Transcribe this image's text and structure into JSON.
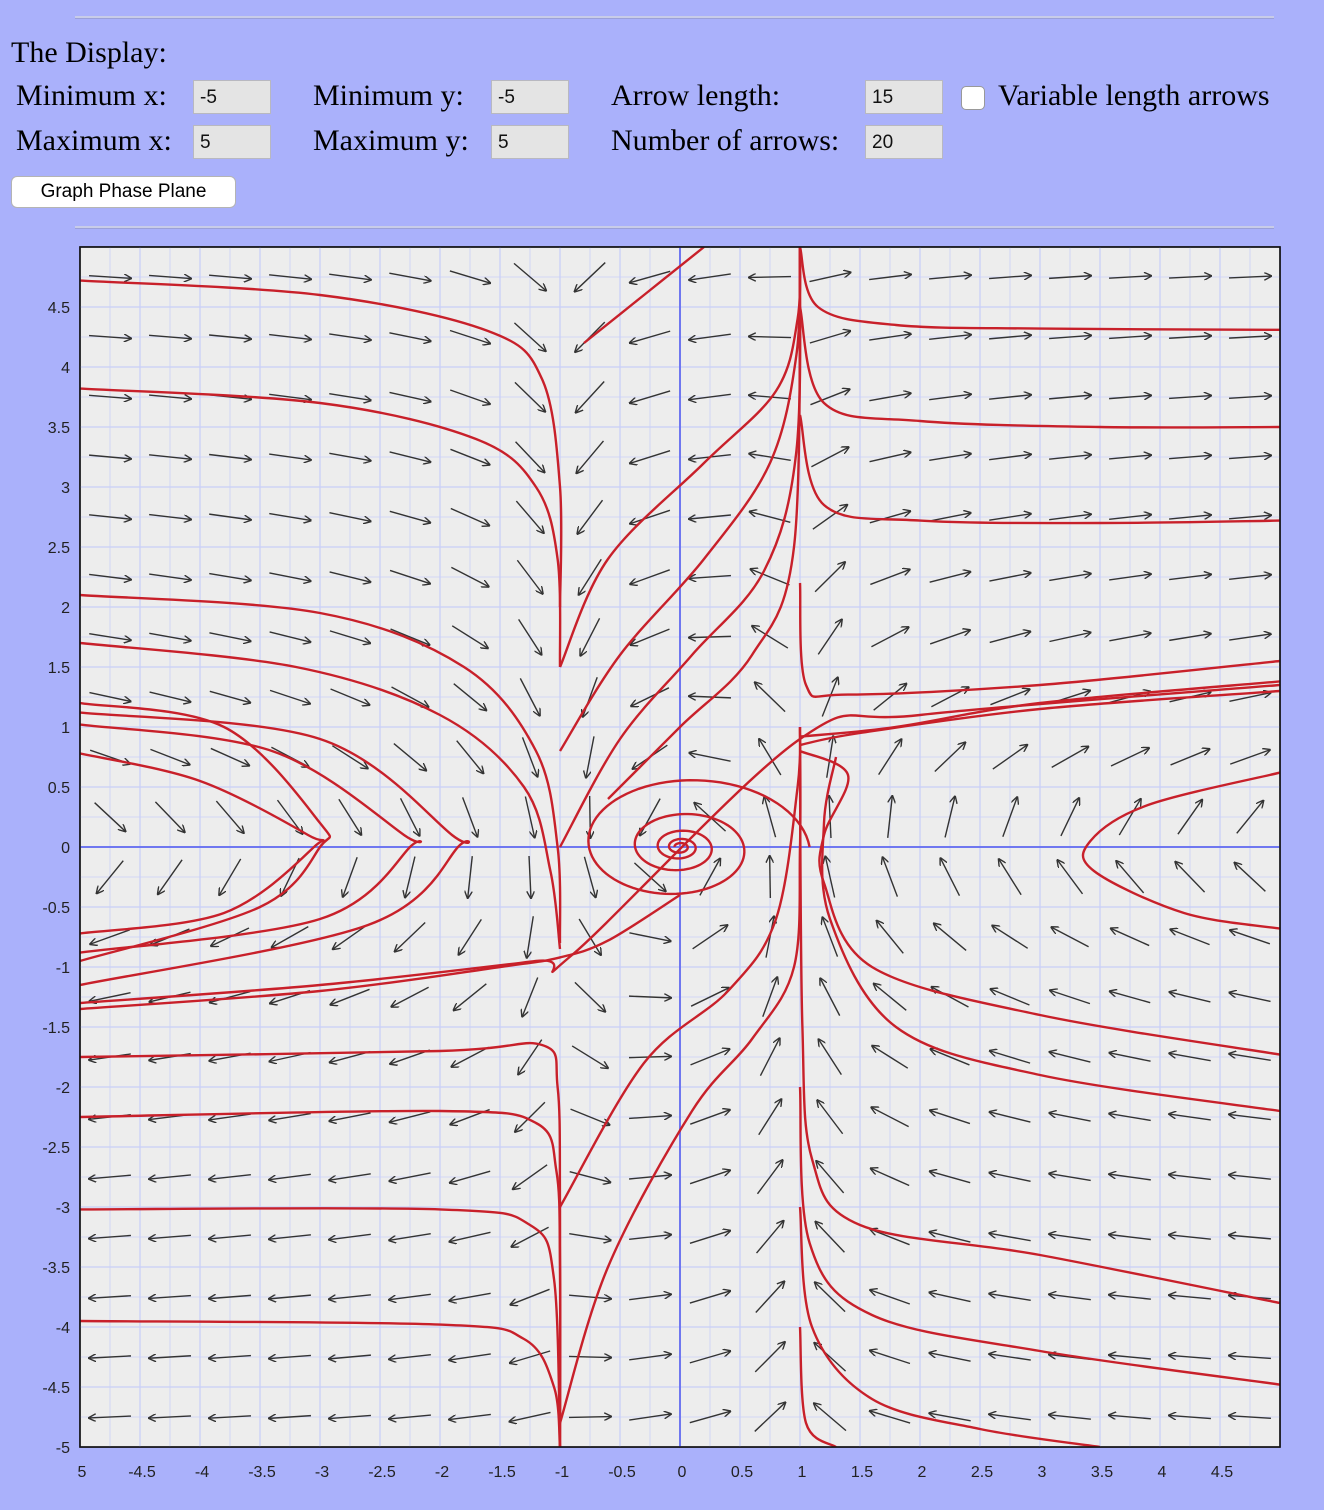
{
  "form": {
    "heading": "The Display:",
    "min_x_label": "Minimum x:",
    "min_x_value": "-5",
    "max_x_label": "Maximum x:",
    "max_x_value": "5",
    "min_y_label": "Minimum y:",
    "min_y_value": "-5",
    "max_y_label": "Maximum y:",
    "max_y_value": "5",
    "arrow_length_label": "Arrow length:",
    "arrow_length_value": "15",
    "num_arrows_label": "Number of arrows:",
    "num_arrows_value": "20",
    "variable_length_label": "Variable length arrows",
    "variable_length_checked": false,
    "graph_button": "Graph Phase Plane"
  },
  "chart_data": {
    "type": "phase-plane",
    "xlim": [
      -5,
      5
    ],
    "ylim": [
      -5,
      5
    ],
    "grid": true,
    "x_ticks": [
      "5",
      "-4.5",
      "-4",
      "-3.5",
      "-3",
      "-2.5",
      "-2",
      "-1.5",
      "-1",
      "-0.5",
      "0",
      "0.5",
      "1",
      "1.5",
      "2",
      "2.5",
      "3",
      "3.5",
      "4",
      "4.5"
    ],
    "x_tick_values": [
      -5,
      -4.5,
      -4,
      -3.5,
      -3,
      -2.5,
      -2,
      -1.5,
      -1,
      -0.5,
      0,
      0.5,
      1,
      1.5,
      2,
      2.5,
      3,
      3.5,
      4,
      4.5
    ],
    "y_ticks": [
      "4.5",
      "4",
      "3.5",
      "3",
      "2.5",
      "2",
      "1.5",
      "1",
      "0.5",
      "0",
      "-0.5",
      "-1",
      "-1.5",
      "-2",
      "-2.5",
      "-3",
      "-3.5",
      "-4",
      "-4.5",
      "-5"
    ],
    "y_tick_values": [
      4.5,
      4,
      3.5,
      3,
      2.5,
      2,
      1.5,
      1,
      0.5,
      0,
      -0.5,
      -1,
      -1.5,
      -2,
      -2.5,
      -3,
      -3.5,
      -4,
      -4.5,
      -5
    ],
    "arrow_grid": {
      "count": 20,
      "length": 15
    },
    "colors": {
      "background": "#ededed",
      "grid": "#c9cff7",
      "axis": "#6f77f0",
      "arrow": "#333333",
      "curve": "#c8202a",
      "page": "#aab1fb"
    },
    "trajectories": [
      {
        "kind": "spiral",
        "cx": 0,
        "cy": 0,
        "r0": 1.2,
        "r1": 0.05,
        "turns": 4.5
      },
      {
        "kind": "polyline",
        "points": [
          [
            -5,
            4.72
          ],
          [
            -3,
            4.6
          ],
          [
            -1.6,
            4.3
          ],
          [
            -1.15,
            3.9
          ],
          [
            -1,
            3.0
          ],
          [
            -1,
            2.0
          ]
        ]
      },
      {
        "kind": "polyline",
        "points": [
          [
            -5,
            3.82
          ],
          [
            -3,
            3.7
          ],
          [
            -1.7,
            3.4
          ],
          [
            -1.2,
            3.0
          ],
          [
            -1.02,
            2.4
          ],
          [
            -1,
            1.5
          ]
        ]
      },
      {
        "kind": "polyline",
        "points": [
          [
            -5,
            2.1
          ],
          [
            -3,
            1.95
          ],
          [
            -1.8,
            1.5
          ],
          [
            -1.2,
            0.8
          ],
          [
            -1.02,
            0
          ],
          [
            -1,
            -0.8
          ]
        ]
      },
      {
        "kind": "polyline",
        "points": [
          [
            -5,
            1.7
          ],
          [
            -3.2,
            1.5
          ],
          [
            -2,
            1.1
          ],
          [
            -1.3,
            0.5
          ],
          [
            -1.08,
            -0.2
          ],
          [
            -1,
            -0.85
          ]
        ]
      },
      {
        "kind": "polyline",
        "points": [
          [
            -5,
            1.2
          ],
          [
            -3.8,
            1.0
          ],
          [
            -3.0,
            0.2
          ],
          [
            -3.0,
            0
          ],
          [
            -3.5,
            -0.5
          ],
          [
            -5,
            -0.95
          ]
        ]
      },
      {
        "kind": "polyline",
        "points": [
          [
            -5,
            0.78
          ],
          [
            -4.0,
            0.55
          ],
          [
            -3.1,
            0.1
          ],
          [
            -3.05,
            0
          ],
          [
            -3.8,
            -0.55
          ],
          [
            -5,
            -0.72
          ]
        ]
      },
      {
        "kind": "polyline",
        "points": [
          [
            -5,
            1.02
          ],
          [
            -3.4,
            0.8
          ],
          [
            -2.3,
            0.1
          ],
          [
            -2.25,
            0
          ],
          [
            -3.0,
            -0.6
          ],
          [
            -5,
            -0.88
          ]
        ]
      },
      {
        "kind": "polyline",
        "points": [
          [
            -5,
            1.12
          ],
          [
            -3.0,
            0.9
          ],
          [
            -1.9,
            0.1
          ],
          [
            -1.85,
            0
          ],
          [
            -2.6,
            -0.65
          ],
          [
            -5,
            -1.15
          ]
        ]
      },
      {
        "kind": "polyline",
        "points": [
          [
            -5,
            -1.35
          ],
          [
            -3,
            -1.2
          ],
          [
            -1.5,
            -1.0
          ],
          [
            -1.0,
            -0.92
          ],
          [
            -0.6,
            -0.78
          ],
          [
            0,
            -0.4
          ]
        ]
      },
      {
        "kind": "polyline",
        "points": [
          [
            -5,
            -1.3
          ],
          [
            -3,
            -1.15
          ],
          [
            -1.2,
            -0.95
          ],
          [
            -0.9,
            -0.9
          ],
          [
            1,
            0.9
          ],
          [
            2,
            1.1
          ],
          [
            5,
            1.35
          ]
        ]
      },
      {
        "kind": "polyline",
        "points": [
          [
            -5,
            -1.75
          ],
          [
            -2,
            -1.7
          ],
          [
            -1.15,
            -1.65
          ],
          [
            -1.02,
            -2.0
          ],
          [
            -1,
            -3.0
          ],
          [
            -1,
            -5
          ]
        ]
      },
      {
        "kind": "polyline",
        "points": [
          [
            -5,
            -2.25
          ],
          [
            -2,
            -2.2
          ],
          [
            -1.2,
            -2.3
          ],
          [
            -1.03,
            -2.7
          ],
          [
            -1,
            -3.5
          ],
          [
            -1,
            -5
          ]
        ]
      },
      {
        "kind": "polyline",
        "points": [
          [
            -5,
            -3.02
          ],
          [
            -2,
            -3.02
          ],
          [
            -1.25,
            -3.15
          ],
          [
            -1.05,
            -3.6
          ],
          [
            -1,
            -5
          ]
        ]
      },
      {
        "kind": "polyline",
        "points": [
          [
            -5,
            -3.95
          ],
          [
            -2,
            -3.98
          ],
          [
            -1.3,
            -4.1
          ],
          [
            -1.05,
            -4.5
          ],
          [
            -1,
            -5
          ]
        ]
      },
      {
        "kind": "polyline",
        "points": [
          [
            -1,
            -4.8
          ],
          [
            -0.6,
            -3.5
          ],
          [
            0.1,
            -2.2
          ],
          [
            0.6,
            -1.6
          ],
          [
            0.95,
            -1.0
          ],
          [
            1,
            0.0
          ],
          [
            1,
            1.0
          ]
        ]
      },
      {
        "kind": "polyline",
        "points": [
          [
            -1,
            -3.0
          ],
          [
            -0.3,
            -1.8
          ],
          [
            0.4,
            -1.2
          ],
          [
            0.8,
            -0.6
          ],
          [
            0.98,
            0.5
          ],
          [
            1,
            1.0
          ]
        ]
      },
      {
        "kind": "polyline",
        "points": [
          [
            -1,
            1.5
          ],
          [
            -0.6,
            2.4
          ],
          [
            0.2,
            3.2
          ],
          [
            0.8,
            3.8
          ],
          [
            0.98,
            4.4
          ],
          [
            1,
            5.0
          ]
        ]
      },
      {
        "kind": "polyline",
        "points": [
          [
            -1,
            0.8
          ],
          [
            -0.5,
            1.6
          ],
          [
            0.2,
            2.4
          ],
          [
            0.75,
            3.2
          ],
          [
            0.97,
            4.1
          ],
          [
            1,
            5.0
          ]
        ]
      },
      {
        "kind": "polyline",
        "points": [
          [
            -1,
            0.0
          ],
          [
            -0.5,
            0.9
          ],
          [
            0.1,
            1.6
          ],
          [
            0.7,
            2.3
          ],
          [
            0.97,
            3.3
          ],
          [
            1,
            5.0
          ]
        ]
      },
      {
        "kind": "polyline",
        "points": [
          [
            -0.6,
            0.4
          ],
          [
            0.0,
            1.0
          ],
          [
            0.6,
            1.6
          ],
          [
            0.95,
            2.5
          ],
          [
            1,
            5.0
          ]
        ]
      },
      {
        "kind": "polyline",
        "points": [
          [
            -0.8,
            4.2
          ],
          [
            -0.3,
            4.6
          ],
          [
            0.2,
            5.0
          ]
        ]
      },
      {
        "kind": "polyline",
        "points": [
          [
            1,
            5.0
          ],
          [
            1.15,
            4.5
          ],
          [
            1.8,
            4.35
          ],
          [
            3,
            4.32
          ],
          [
            5,
            4.31
          ]
        ]
      },
      {
        "kind": "polyline",
        "points": [
          [
            1,
            4.5
          ],
          [
            1.2,
            3.7
          ],
          [
            2,
            3.55
          ],
          [
            3.5,
            3.5
          ],
          [
            5,
            3.5
          ]
        ]
      },
      {
        "kind": "polyline",
        "points": [
          [
            1,
            3.6
          ],
          [
            1.2,
            2.85
          ],
          [
            2,
            2.72
          ],
          [
            3.5,
            2.7
          ],
          [
            5,
            2.72
          ]
        ]
      },
      {
        "kind": "polyline",
        "points": [
          [
            1,
            2.2
          ],
          [
            1.05,
            1.35
          ],
          [
            1.4,
            1.27
          ],
          [
            3,
            1.35
          ],
          [
            5,
            1.55
          ]
        ]
      },
      {
        "kind": "polyline",
        "points": [
          [
            1,
            0.92
          ],
          [
            1.8,
            1.0
          ],
          [
            3,
            1.2
          ],
          [
            5,
            1.38
          ]
        ]
      },
      {
        "kind": "polyline",
        "points": [
          [
            1,
            0.85
          ],
          [
            1.5,
            0.95
          ],
          [
            3,
            1.15
          ],
          [
            5,
            1.3
          ]
        ]
      },
      {
        "kind": "polyline",
        "points": [
          [
            5,
            0.62
          ],
          [
            3.9,
            0.35
          ],
          [
            3.42,
            0.05
          ],
          [
            3.45,
            -0.2
          ],
          [
            4.2,
            -0.55
          ],
          [
            5,
            -0.68
          ]
        ]
      },
      {
        "kind": "polyline",
        "points": [
          [
            1,
            0.8
          ],
          [
            1.4,
            0.6
          ],
          [
            1.2,
            0.1
          ],
          [
            1.2,
            -0.3
          ],
          [
            1.6,
            -1.0
          ],
          [
            3,
            -1.4
          ],
          [
            5,
            -1.73
          ]
        ]
      },
      {
        "kind": "polyline",
        "points": [
          [
            1.3,
            0.75
          ],
          [
            1.2,
            0.2
          ],
          [
            1.25,
            -0.6
          ],
          [
            1.8,
            -1.5
          ],
          [
            3,
            -1.9
          ],
          [
            5,
            -2.2
          ]
        ]
      },
      {
        "kind": "polyline",
        "points": [
          [
            1,
            0.6
          ],
          [
            1.02,
            -1.5
          ],
          [
            1.1,
            -2.6
          ],
          [
            1.5,
            -3.15
          ],
          [
            3,
            -3.4
          ],
          [
            5,
            -3.8
          ]
        ]
      },
      {
        "kind": "polyline",
        "points": [
          [
            1,
            -2.0
          ],
          [
            1.08,
            -3.3
          ],
          [
            1.6,
            -3.9
          ],
          [
            3,
            -4.2
          ],
          [
            5,
            -4.48
          ]
        ]
      },
      {
        "kind": "polyline",
        "points": [
          [
            1,
            -3.0
          ],
          [
            1.1,
            -4.0
          ],
          [
            1.6,
            -4.6
          ],
          [
            2.5,
            -4.85
          ],
          [
            3.5,
            -5.0
          ]
        ]
      },
      {
        "kind": "polyline",
        "points": [
          [
            1,
            -4.0
          ],
          [
            1.05,
            -4.8
          ],
          [
            1.3,
            -5.0
          ]
        ]
      }
    ]
  }
}
